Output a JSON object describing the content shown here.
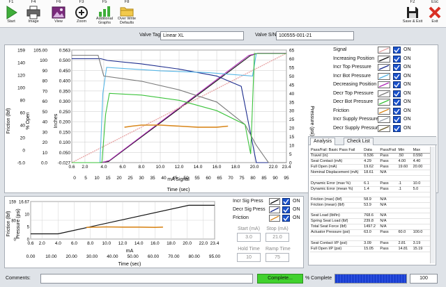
{
  "toolbar": {
    "buttons": [
      {
        "key": "F1",
        "label": "Start",
        "icon": "play-icon"
      },
      {
        "key": "F4",
        "label": "Image",
        "icon": "printer-icon"
      },
      {
        "key": "F6",
        "label": "View",
        "icon": "image-icon"
      },
      {
        "key": "F3",
        "label": "Zoom",
        "icon": "zoom-plus-icon"
      },
      {
        "key": "F5",
        "label": "Additional\nGraphs",
        "icon": "bar-graph-icon"
      },
      {
        "key": "F8",
        "label": "Over Write\nDefaults",
        "icon": "folder-icon"
      }
    ],
    "right_buttons": [
      {
        "key": "F2",
        "label": "Save & Exit",
        "icon": "floppy-icon"
      },
      {
        "key": "Esc",
        "label": "Exit",
        "icon": "close-icon"
      }
    ]
  },
  "form": {
    "valve_tag_label": "Valve Tag:",
    "valve_tag_value": "Linear XL",
    "valve_sn_label": "Valve S/N:",
    "valve_sn_value": "100555-001-21"
  },
  "legend": [
    {
      "name": "Signal",
      "color": "#e8a7a7",
      "on": "ON"
    },
    {
      "name": "Increasing Position",
      "color": "#111111",
      "on": "ON"
    },
    {
      "name": "Incr Top Pressure",
      "color": "#1a2a8c",
      "on": "ON"
    },
    {
      "name": "Incr Bot Pressure",
      "color": "#56b6e6",
      "on": "ON"
    },
    {
      "name": "Decreasing Position",
      "color": "#b02ab8",
      "on": "ON"
    },
    {
      "name": "Decr Top Pressure",
      "color": "#7a7a7a",
      "on": "ON"
    },
    {
      "name": "Decr Bot Pressure",
      "color": "#3ac23a",
      "on": "ON"
    },
    {
      "name": "Friction",
      "color": "#d9881e",
      "on": "ON"
    },
    {
      "name": "Incr Supply Pressure",
      "color": "#9aa3ad",
      "on": "ON"
    },
    {
      "name": "Decr Supply Pressure",
      "color": "#6a5a2a",
      "on": "ON"
    }
  ],
  "chart_data": [
    {
      "type": "line",
      "axes": {
        "friction_label": "Friction (lbf)",
        "open_label": "% Open",
        "inches_label": "Inches",
        "pressure_label": "Pressure (psi)",
        "x_label": "mA Signal",
        "x2_label": "Time (sec)",
        "friction_ticks": [
          "159",
          "140",
          "120",
          "100",
          "80",
          "60",
          "40",
          "20",
          "0",
          "-5.0"
        ],
        "open_ticks": [
          "105.00",
          "100",
          "90",
          "80",
          "70",
          "60",
          "50",
          "40",
          "30",
          "20",
          "10",
          "0.0"
        ],
        "inches_ticks": [
          "0.563",
          "0.500",
          "0.450",
          "0.400",
          "0.350",
          "0.300",
          "0.250",
          "0.200",
          "0.150",
          "0.100",
          "0.050",
          "-0.027"
        ],
        "pressure_ticks": [
          "65",
          "60",
          "55",
          "50",
          "45",
          "40",
          "35",
          "30",
          "25",
          "20",
          "15",
          "10",
          "5",
          "0"
        ],
        "ma_ticks": [
          "0.6",
          "2.0",
          "4.0",
          "6.0",
          "8.0",
          "10.0",
          "12.0",
          "14.0",
          "16.0",
          "18.0",
          "20.0",
          "22.0",
          "23.4"
        ],
        "time_ticks": [
          "0",
          "5",
          "10",
          "15",
          "20",
          "25",
          "30",
          "35",
          "40",
          "45",
          "50",
          "55",
          "60",
          "65",
          "70",
          "75",
          "80",
          "85",
          "90",
          "95"
        ]
      },
      "x_range_ma": [
        0.6,
        23.4
      ],
      "y_range_open": [
        0,
        105
      ],
      "series": [
        {
          "name": "Increasing Position",
          "x": [
            0.6,
            3.5,
            4.5,
            19.6,
            20.4,
            23.4
          ],
          "y": [
            0,
            0,
            1,
            100,
            102,
            102
          ]
        },
        {
          "name": "Decreasing Position",
          "x": [
            23.4,
            20.4,
            19.4,
            4.6,
            3.8,
            0.6
          ],
          "y": [
            102,
            102,
            100,
            2,
            0,
            0
          ]
        },
        {
          "name": "Signal",
          "x": [
            0.6,
            23.4
          ],
          "y": [
            -3,
            102
          ]
        },
        {
          "name": "Incr Top Pressure",
          "x": [
            0.6,
            3.7,
            4.4,
            8,
            12,
            16,
            18.6,
            19.4,
            20.2,
            23.4
          ],
          "y": [
            60,
            60,
            59,
            57,
            54,
            50,
            44,
            22,
            0,
            0
          ]
        },
        {
          "name": "Incr Bot Pressure",
          "x": [
            0.6,
            3.6,
            3.9,
            4.3,
            10,
            15,
            19.8,
            20.2,
            23.4
          ],
          "y": [
            0,
            0,
            40,
            55,
            53,
            52,
            50,
            63,
            63
          ]
        },
        {
          "name": "Decr Top Pressure",
          "x": [
            0.6,
            3.4,
            4.0,
            8,
            12,
            16,
            19.0,
            20.2,
            21.5,
            23.4
          ],
          "y": [
            62,
            62,
            50,
            47,
            42,
            35,
            22,
            10,
            0,
            0
          ]
        },
        {
          "name": "Decr Bot Pressure",
          "x": [
            0.6,
            3.8,
            4.2,
            4.6,
            8,
            12,
            16,
            19.0,
            19.6,
            20.0,
            23.4
          ],
          "y": [
            0,
            0,
            28,
            40,
            39,
            36,
            30,
            22,
            5,
            63,
            63
          ]
        },
        {
          "name": "Friction",
          "x": [
            6.2,
            7.0,
            8,
            10,
            12,
            14,
            16,
            17.2
          ],
          "y": [
            33,
            34,
            35,
            35,
            34,
            33,
            33,
            34
          ]
        }
      ]
    },
    {
      "type": "line",
      "axes": {
        "friction_label": "Friction (lbf)",
        "pressure_label": "Pressure (psi)",
        "x_label": "mA",
        "x2_label": "Time (sec)",
        "friction_ticks": [
          "159",
          "80",
          "0"
        ],
        "pressure_ticks": [
          "16.67",
          "10",
          "5",
          "0"
        ],
        "ma_ticks": [
          "0.6",
          "2.0",
          "4.0",
          "6.0",
          "8.0",
          "10.0",
          "12.0",
          "14.0",
          "16.0",
          "18.0",
          "20.0",
          "22.0",
          "23.4"
        ],
        "time_ticks": [
          "0.00",
          "10.00",
          "20.00",
          "30.00",
          "40.00",
          "50.00",
          "60.00",
          "70.00",
          "80.00",
          "95.00"
        ]
      },
      "legend": [
        {
          "name": "Incr Sig Press",
          "color": "#111111",
          "on": "ON"
        },
        {
          "name": "Decr Sig Press",
          "color": "#1a2a8c",
          "on": "ON"
        },
        {
          "name": "Friction",
          "color": "#d9881e",
          "on": "ON"
        }
      ],
      "series": [
        {
          "name": "Incr Sig Press",
          "x": [
            0.6,
            4.0,
            20.2,
            23.4
          ],
          "y": [
            2.3,
            2.3,
            15,
            15
          ]
        },
        {
          "name": "Friction",
          "x": [
            7.5,
            10,
            12,
            14,
            16,
            17
          ],
          "y": [
            5.2,
            5.4,
            5.3,
            5.3,
            5.2,
            5.3
          ]
        }
      ]
    }
  ],
  "settings": {
    "start_label": "Start (mA)",
    "start_value": "3.0",
    "stop_label": "Stop (mA)",
    "stop_value": "21.0",
    "hold_label": "Hold Time",
    "hold_value": "10",
    "ramp_label": "Ramp Time",
    "ramp_value": "75"
  },
  "analysis": {
    "tabs": [
      "Analysis",
      "Check List"
    ],
    "header": [
      "Pass/Fail: Basic Pass Fail",
      "Data",
      "Pass/Fail",
      "Min",
      "Max"
    ],
    "rows": [
      [
        "Travel (in)",
        "0.536",
        "Pass",
        ".50",
        "0.550"
      ],
      [
        "Seat Contact (mA)",
        "4.29",
        "Pass",
        "4.00",
        "4.40"
      ],
      [
        "Full Open (mA)",
        "19.62",
        "Pass",
        "19.60",
        "20.00"
      ],
      [
        "Nominal Displacement (mA)",
        "18.61",
        "N/A",
        "",
        ""
      ],
      [
        "",
        "",
        "",
        "",
        ""
      ],
      [
        "Dynamic Error (max %)",
        "6.1",
        "Pass",
        ".1",
        "10.0"
      ],
      [
        "Dynamic Error (mean %)",
        "1.4",
        "Pass",
        ".1",
        "5.0"
      ],
      [
        "",
        "",
        "",
        "",
        ""
      ],
      [
        "Friction (max) (lbf)",
        "58.9",
        "N/A",
        "",
        ""
      ],
      [
        "Friction (mean) (lbf)",
        "53.9",
        "N/A",
        "",
        ""
      ],
      [
        "",
        "",
        "",
        "",
        ""
      ],
      [
        "Seat Load (lbf/in)",
        "768.6",
        "N/A",
        "",
        ""
      ],
      [
        "Spring Seat Load (lbf)",
        "239.8",
        "N/A",
        "",
        ""
      ],
      [
        "Total Seat Force (lbf)",
        "1497.2",
        "N/A",
        "",
        ""
      ],
      [
        "Actuator Pressure (psi)",
        "63.0",
        "Pass",
        "60.0",
        "100.0"
      ],
      [
        "",
        "",
        "",
        "",
        ""
      ],
      [
        "Seat Contact I/P (psi)",
        "3.09",
        "Pass",
        "2.81",
        "3.19"
      ],
      [
        "Full Open I/P (psi)",
        "15.05",
        "Pass",
        "14.81",
        "15.19"
      ]
    ]
  },
  "bottom": {
    "comments_label": "Comments:",
    "status": "Complete...",
    "pct_label": "% Complete",
    "pct_value": "100",
    "progress": 1.0
  }
}
